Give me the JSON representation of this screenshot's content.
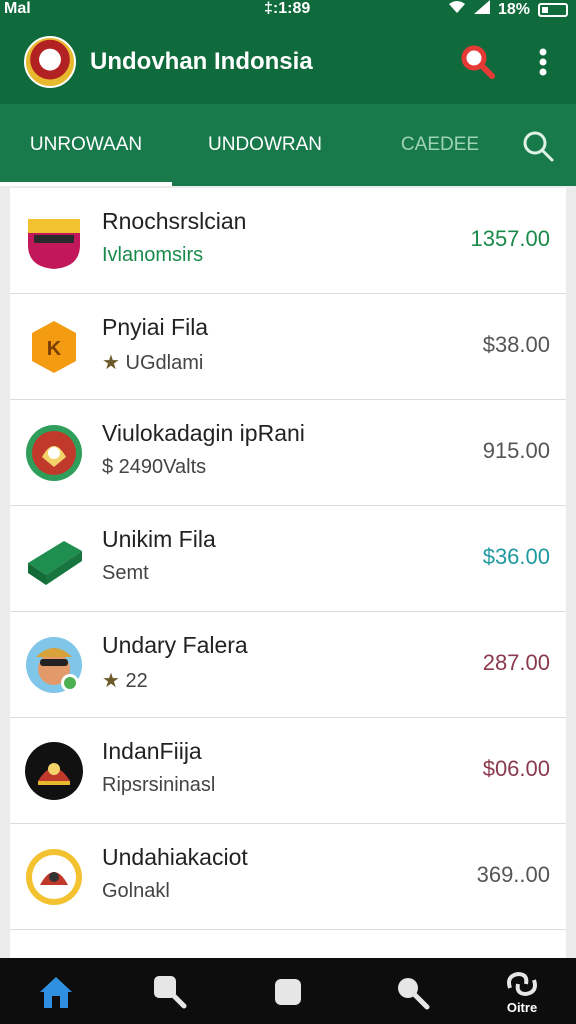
{
  "status_bar": {
    "carrier": "Mal",
    "time": "‡:1:89",
    "battery": "18%"
  },
  "app": {
    "title": "Undovhan Indonsia"
  },
  "tabs": [
    {
      "label": "UNROWAAN"
    },
    {
      "label": "UNDOWRAN"
    },
    {
      "label": "CAEDEE"
    }
  ],
  "items": [
    {
      "name": "Rnochsrslcian",
      "sub": "Ivlanomsirs",
      "price": "1357.00",
      "sub_color": "#1a8a4a",
      "price_color": "#1a8a4a"
    },
    {
      "name": "Pnyiai Fila",
      "sub": "UGdlami",
      "sub_icon": "star-icon",
      "price": "$38.00",
      "price_color": "#555555"
    },
    {
      "name": "Viulokadagin ipRani",
      "sub": "$ 2490Valts",
      "price": "915.00",
      "price_color": "#555555"
    },
    {
      "name": "Unikim Fila",
      "sub": "Semt",
      "price": "$36.00",
      "price_color": "#1f9aa0"
    },
    {
      "name": "Undary Falera",
      "sub": "22",
      "sub_icon": "star-icon",
      "price": "287.00",
      "price_color": "#8a3a4c"
    },
    {
      "name": "IndanFiija",
      "sub": "Ripsrsininasl",
      "price": "$06.00",
      "price_color": "#8a3a4c"
    },
    {
      "name": "Undahiakaciot",
      "sub": "Golnakl",
      "price": "369..00",
      "price_color": "#555555"
    }
  ],
  "bottom_nav": {
    "last_label": "Oitre"
  },
  "colors": {
    "primary": "#0f6a3c",
    "tab_bar": "#187a4a",
    "search_accent": "#e53935",
    "home_active": "#2f8fe0"
  }
}
